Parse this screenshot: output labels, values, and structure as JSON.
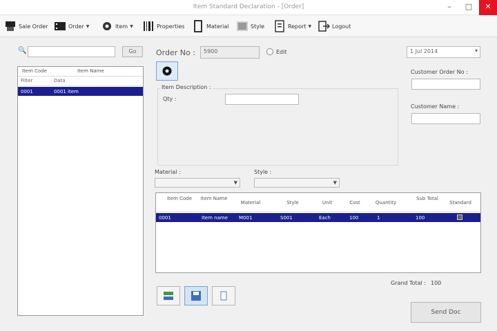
{
  "window": {
    "title": "Item Standard Declaration - [Order]"
  },
  "toolbar": {
    "items": [
      {
        "label": "Sale Order",
        "icon": "printer-icon"
      },
      {
        "label": "Order",
        "icon": "film-icon"
      },
      {
        "label": "Item",
        "icon": "gear-icon"
      },
      {
        "label": "Properties",
        "icon": "barcode-icon"
      },
      {
        "label": "Material",
        "icon": "door-icon"
      },
      {
        "label": "Style",
        "icon": "style-icon"
      },
      {
        "label": "Report",
        "icon": "report-icon"
      },
      {
        "label": "Logout",
        "icon": "logout-icon"
      }
    ]
  },
  "left": {
    "search_button": "Go",
    "columns": [
      "Item Code",
      "Item Name"
    ],
    "filter_row": [
      "Filter",
      "Data"
    ],
    "selected_row": [
      "0001",
      "0001 item"
    ]
  },
  "form": {
    "order_no_label": "Order No :",
    "order_no_value": "5900",
    "edit_label": "Edit",
    "date_value": "1 Jul 2014",
    "customer_order_label": "Customer Order No :",
    "customer_name_label": "Customer Name :",
    "item_description_label": "Item Description :",
    "qty_label": "Qty :",
    "material_label": "Material :",
    "style_label": "Style :"
  },
  "grid": {
    "columns": [
      "Item Code",
      "Item Name",
      "Material",
      "Style",
      "Unit",
      "Cost",
      "Quantity",
      "Sub Total",
      "Standard"
    ],
    "selected_row": [
      "0001",
      "Item name",
      "M001",
      "S001",
      "Each",
      "100",
      "1",
      "100",
      ""
    ]
  },
  "footer": {
    "grand_total_label": "Grand Total :",
    "grand_total_value": "100",
    "save_button": "Send Doc"
  }
}
